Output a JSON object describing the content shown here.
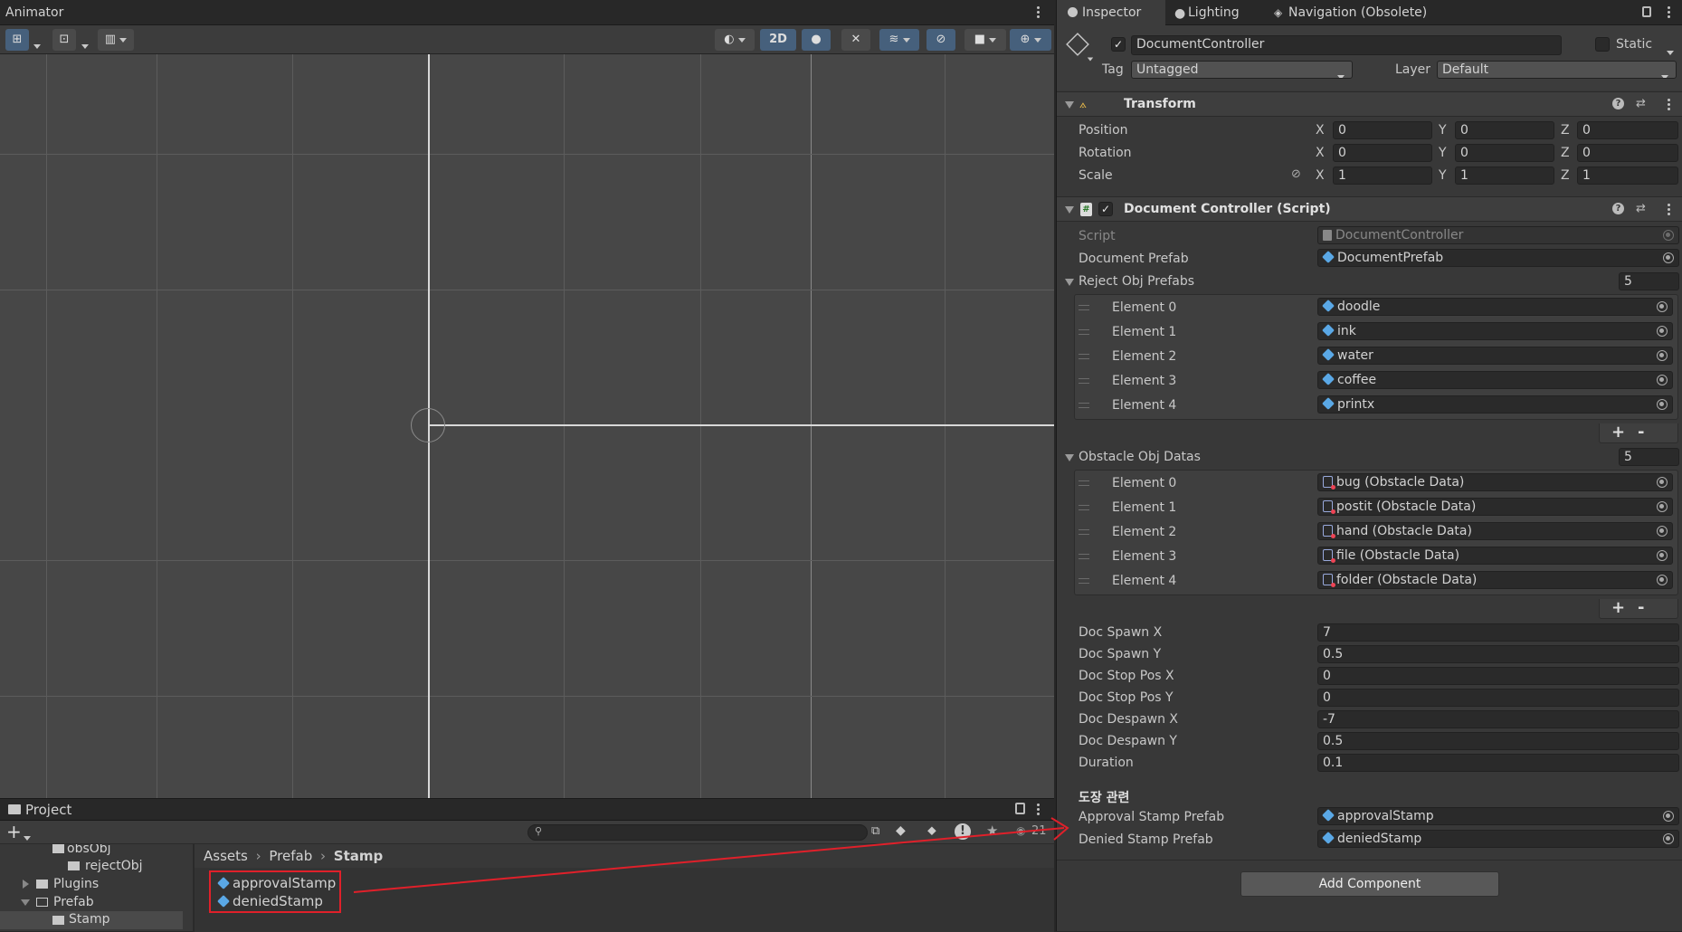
{
  "scene": {
    "tab_title": "Animator",
    "toolbar": {
      "mode_2d": "2D"
    }
  },
  "project": {
    "tab_title": "Project",
    "add_label": "+",
    "search_placeholder": "",
    "count": "21",
    "tree": [
      {
        "label": "obsObj"
      },
      {
        "label": "rejectObj"
      },
      {
        "label": "Plugins"
      },
      {
        "label": "Prefab"
      },
      {
        "label": "Stamp"
      }
    ],
    "breadcrumb": [
      "Assets",
      "Prefab",
      "Stamp"
    ],
    "assets": [
      "approvalStamp",
      "deniedStamp"
    ],
    "annotation_color": "#e0202a"
  },
  "inspector": {
    "tabs": [
      "Inspector",
      "Lighting",
      "Navigation (Obsolete)"
    ],
    "object_name": "DocumentController",
    "static_label": "Static",
    "tag_label": "Tag",
    "tag_value": "Untagged",
    "layer_label": "Layer",
    "layer_value": "Default",
    "transform": {
      "title": "Transform",
      "rows": [
        {
          "label": "Position",
          "x": "0",
          "y": "0",
          "z": "0"
        },
        {
          "label": "Rotation",
          "x": "0",
          "y": "0",
          "z": "0"
        },
        {
          "label": "Scale",
          "x": "1",
          "y": "1",
          "z": "1"
        }
      ]
    },
    "script": {
      "title": "Document Controller (Script)",
      "script_label": "Script",
      "script_value": "DocumentController",
      "doc_prefab_label": "Document Prefab",
      "doc_prefab_value": "DocumentPrefab",
      "reject_label": "Reject Obj Prefabs",
      "reject_count": "5",
      "reject_items": [
        {
          "label": "Element 0",
          "value": "doodle"
        },
        {
          "label": "Element 1",
          "value": "ink"
        },
        {
          "label": "Element 2",
          "value": "water"
        },
        {
          "label": "Element 3",
          "value": "coffee"
        },
        {
          "label": "Element 4",
          "value": "printx"
        }
      ],
      "obstacle_label": "Obstacle Obj Datas",
      "obstacle_count": "5",
      "obstacle_items": [
        {
          "label": "Element 0",
          "value": "bug (Obstacle Data)"
        },
        {
          "label": "Element 1",
          "value": "postit (Obstacle Data)"
        },
        {
          "label": "Element 2",
          "value": "hand (Obstacle Data)"
        },
        {
          "label": "Element 3",
          "value": "file (Obstacle Data)"
        },
        {
          "label": "Element 4",
          "value": "folder (Obstacle Data)"
        }
      ],
      "plus": "+",
      "minus": "-",
      "params": [
        {
          "label": "Doc Spawn X",
          "value": "7"
        },
        {
          "label": "Doc Spawn Y",
          "value": "0.5"
        },
        {
          "label": "Doc Stop Pos X",
          "value": "0"
        },
        {
          "label": "Doc Stop Pos Y",
          "value": "0"
        },
        {
          "label": "Doc Despawn X",
          "value": "-7"
        },
        {
          "label": "Doc Despawn Y",
          "value": "0.5"
        },
        {
          "label": "Duration",
          "value": "0.1"
        }
      ],
      "stamp_header": "도장 관련",
      "approval_label": "Approval Stamp Prefab",
      "approval_value": "approvalStamp",
      "denied_label": "Denied Stamp Prefab",
      "denied_value": "deniedStamp"
    },
    "add_component": "Add Component"
  }
}
